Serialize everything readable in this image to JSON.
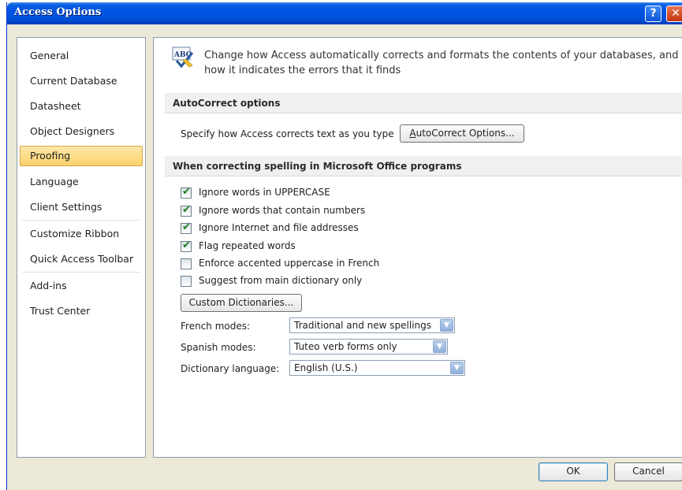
{
  "window": {
    "title": "Access Options",
    "help_glyph": "?",
    "close_glyph": "✕"
  },
  "sidebar": {
    "items": [
      {
        "label": "General"
      },
      {
        "label": "Current Database"
      },
      {
        "label": "Datasheet"
      },
      {
        "label": "Object Designers"
      },
      {
        "label": "Proofing",
        "selected": true
      },
      {
        "label": "Language"
      },
      {
        "label": "Client Settings"
      },
      {
        "label": "Customize Ribbon"
      },
      {
        "label": "Quick Access Toolbar"
      },
      {
        "label": "Add-ins"
      },
      {
        "label": "Trust Center"
      }
    ]
  },
  "header": {
    "icon": "abc-proofing-icon",
    "description": "Change how Access automatically corrects and formats the contents of your databases, and how it indicates the errors that it finds"
  },
  "autocorrect": {
    "section_title": "AutoCorrect options",
    "description": "Specify how Access corrects text as you type",
    "button_label": "AutoCorrect Options..."
  },
  "spelling": {
    "section_title": "When correcting spelling in Microsoft Office programs",
    "checkboxes": [
      {
        "label": "Ignore words in UPPERCASE",
        "checked": true
      },
      {
        "label": "Ignore words that contain numbers",
        "checked": true
      },
      {
        "label": "Ignore Internet and file addresses",
        "checked": true
      },
      {
        "label": "Flag repeated words",
        "checked": true
      },
      {
        "label": "Enforce accented uppercase in French",
        "checked": false
      },
      {
        "label": "Suggest from main dictionary only",
        "checked": false
      }
    ],
    "custom_dictionaries_label": "Custom Dictionaries...",
    "french_modes": {
      "label": "French modes:",
      "value": "Traditional and new spellings"
    },
    "spanish_modes": {
      "label": "Spanish modes:",
      "value": "Tuteo verb forms only"
    },
    "dictionary_language": {
      "label": "Dictionary language:",
      "value": "English (U.S.)"
    }
  },
  "footer": {
    "ok_label": "OK",
    "cancel_label": "Cancel"
  },
  "colors": {
    "titlebar": "#0054e3",
    "selected_nav": "#fbd26a",
    "check_mark": "#1b7e1b"
  }
}
